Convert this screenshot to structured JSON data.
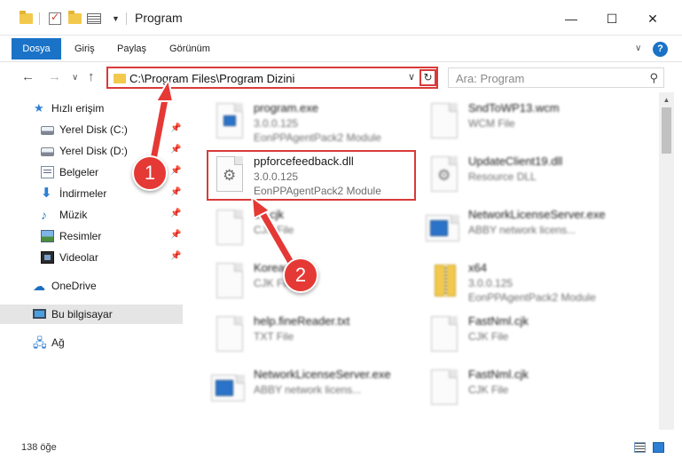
{
  "window": {
    "title": "Program",
    "minimize": "—",
    "maximize": "☐",
    "close": "✕"
  },
  "ribbon": {
    "tabs": [
      "Dosya",
      "Giriş",
      "Paylaş",
      "Görünüm"
    ],
    "help": "?",
    "collapse": "∨"
  },
  "address": {
    "path": "C:\\Program Files\\Program Dizini",
    "refresh": "↻",
    "dropdown": "∨"
  },
  "search": {
    "placeholder": "Ara: Program"
  },
  "nav": {
    "back": "←",
    "forward": "→",
    "recent": "∨",
    "up": "↑"
  },
  "sidebar": {
    "items": [
      {
        "label": "Hızlı erişim",
        "icon": "star-icon"
      },
      {
        "label": "Yerel Disk (C:)",
        "icon": "drive-icon",
        "pinned": true
      },
      {
        "label": "Yerel Disk (D:)",
        "icon": "drive-icon",
        "pinned": true
      },
      {
        "label": "Belgeler",
        "icon": "documents-icon",
        "pinned": true
      },
      {
        "label": "İndirmeler",
        "icon": "download-icon",
        "pinned": true
      },
      {
        "label": "Müzik",
        "icon": "music-icon",
        "pinned": true
      },
      {
        "label": "Resimler",
        "icon": "pictures-icon",
        "pinned": true
      },
      {
        "label": "Videolar",
        "icon": "videos-icon",
        "pinned": true
      },
      {
        "label": "OneDrive",
        "icon": "cloud-icon"
      },
      {
        "label": "Bu bilgisayar",
        "icon": "computer-icon",
        "selected": true
      },
      {
        "label": "Ağ",
        "icon": "network-icon"
      }
    ]
  },
  "files": [
    {
      "name": "program.exe",
      "line1": "3.0.0.125",
      "line2": "EonPPAgentPack2 Module",
      "icon": "exe-icon"
    },
    {
      "name": "SndToWP13.wcm",
      "line1": "WCM File",
      "line2": "",
      "icon": "file-icon"
    },
    {
      "name": "ppforcefeedback.dll",
      "line1": "3.0.0.125",
      "line2": "EonPPAgentPack2 Module",
      "icon": "dll-icon"
    },
    {
      "name": "UpdateClient19.dll",
      "line1": "Resource DLL",
      "line2": "",
      "icon": "dll-icon"
    },
    {
      "name": "de.cjk",
      "line1": "CJK File",
      "line2": "",
      "icon": "file-icon"
    },
    {
      "name": "NetworkLicenseServer.exe",
      "line1": "ABBY network licens...",
      "line2": "",
      "icon": "app-icon"
    },
    {
      "name": "Korean.cjk",
      "line1": "CJK File",
      "line2": "",
      "icon": "file-icon"
    },
    {
      "name": "x64",
      "line1": "3.0.0.125",
      "line2": "EonPPAgentPack2 Module",
      "icon": "zip-folder-icon"
    },
    {
      "name": "help.fineReader.txt",
      "line1": "TXT File",
      "line2": "",
      "icon": "file-icon"
    },
    {
      "name": "FastNml.cjk",
      "line1": "CJK File",
      "line2": "",
      "icon": "file-icon"
    },
    {
      "name": "NetworkLicenseServer.exe",
      "line1": "ABBY network licens...",
      "line2": "",
      "icon": "app-icon"
    },
    {
      "name": "FastNml.cjk",
      "line1": "CJK File",
      "line2": "",
      "icon": "file-icon"
    }
  ],
  "status": {
    "count": "138 öğe"
  },
  "annotations": {
    "marker1": "1",
    "marker2": "2",
    "color": "#e53935"
  },
  "colors": {
    "accent": "#1a73c7",
    "highlight": "#d93a3a",
    "selected_row": "#e5e5e5"
  }
}
